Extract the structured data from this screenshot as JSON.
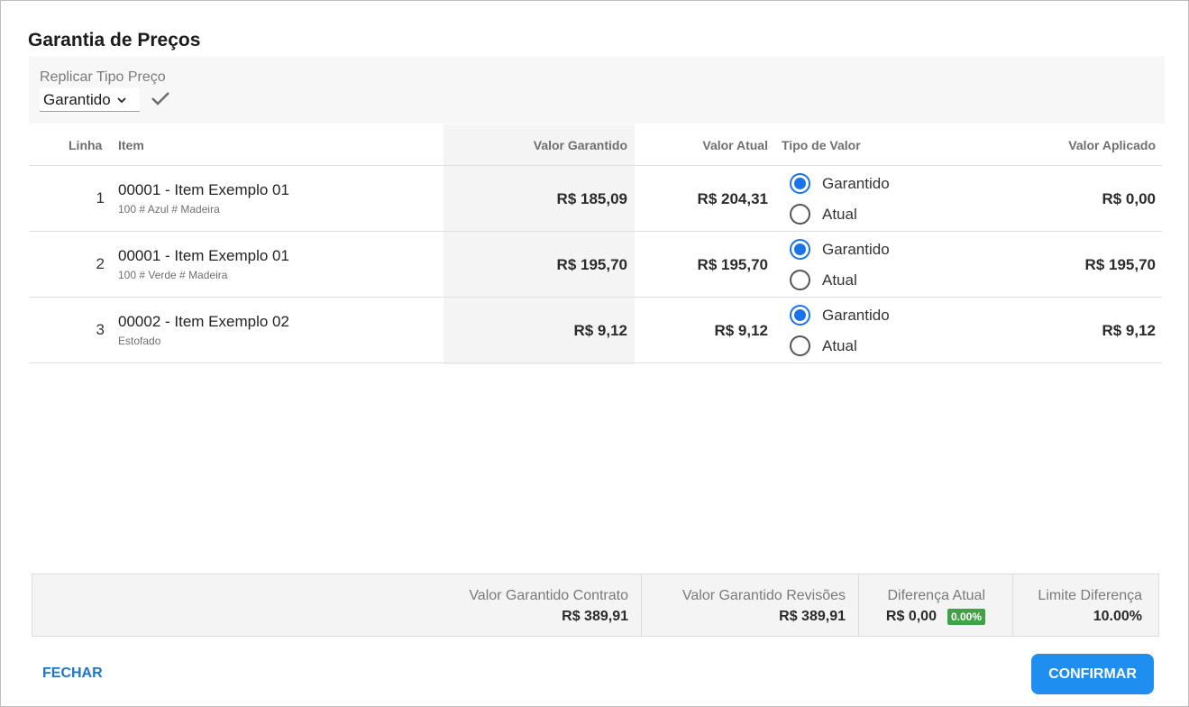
{
  "dialog": {
    "title": "Garantia de Preços"
  },
  "replicar": {
    "label": "Replicar Tipo Preço",
    "selected": "Garantido"
  },
  "table": {
    "headers": {
      "linha": "Linha",
      "item": "Item",
      "valor_garantido": "Valor Garantido",
      "valor_atual": "Valor Atual",
      "tipo_valor": "Tipo de Valor",
      "valor_aplicado": "Valor Aplicado"
    },
    "radio_labels": {
      "garantido": "Garantido",
      "atual": "Atual"
    },
    "rows": [
      {
        "linha": "1",
        "item": "00001 - Item Exemplo 01",
        "desc": "100 # Azul # Madeira",
        "valor_garantido": "R$ 185,09",
        "valor_atual": "R$ 204,31",
        "tipo": "Garantido",
        "valor_aplicado": "R$ 0,00"
      },
      {
        "linha": "2",
        "item": "00001 - Item Exemplo 01",
        "desc": "100 # Verde # Madeira",
        "valor_garantido": "R$ 195,70",
        "valor_atual": "R$ 195,70",
        "tipo": "Garantido",
        "valor_aplicado": "R$ 195,70"
      },
      {
        "linha": "3",
        "item": "00002 - Item Exemplo 02",
        "desc": "Estofado",
        "valor_garantido": "R$ 9,12",
        "valor_atual": "R$ 9,12",
        "tipo": "Garantido",
        "valor_aplicado": "R$ 9,12"
      }
    ]
  },
  "summary": {
    "contrato_label": "Valor Garantido Contrato",
    "contrato_value": "R$ 389,91",
    "revisoes_label": "Valor Garantido Revisões",
    "revisoes_value": "R$ 389,91",
    "diferenca_label": "Diferença Atual",
    "diferenca_value": "R$ 0,00",
    "diferenca_badge": "0.00%",
    "limite_label": "Limite Diferença",
    "limite_value": "10.00%"
  },
  "actions": {
    "close_label": "FECHAR",
    "confirm_label": "CONFIRMAR"
  },
  "colors": {
    "accent": "#1f8ef1",
    "link": "#1f76c7",
    "badge": "#43a047"
  }
}
